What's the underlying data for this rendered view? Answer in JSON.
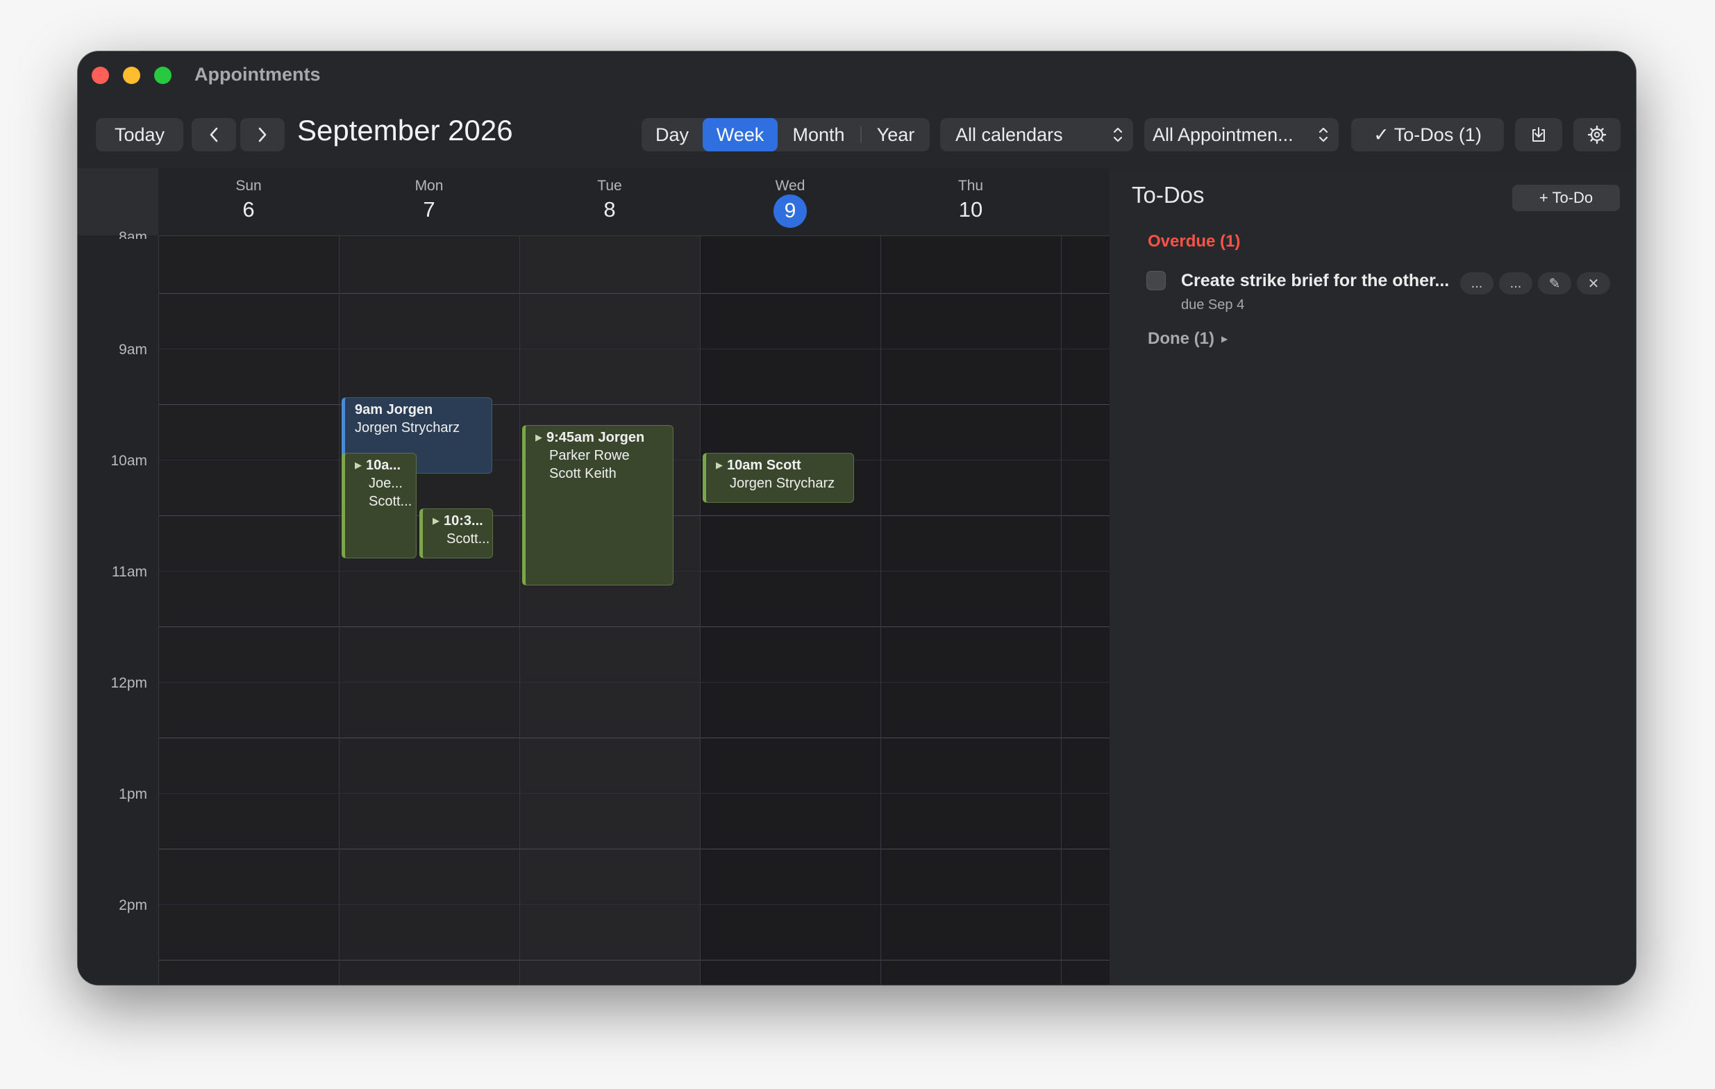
{
  "window": {
    "title": "Appointments"
  },
  "toolbar": {
    "today_label": "Today",
    "month_title": "September 2026",
    "view_modes": [
      "Day",
      "Week",
      "Month",
      "Year"
    ],
    "active_view": "Week",
    "calendar_filter": "All calendars",
    "appointment_filter": "All Appointmen...",
    "todos_toggle": "✓ To-Dos (1)"
  },
  "calendar": {
    "days": [
      {
        "dow": "Sun",
        "num": "6"
      },
      {
        "dow": "Mon",
        "num": "7"
      },
      {
        "dow": "Tue",
        "num": "8"
      },
      {
        "dow": "Wed",
        "num": "9",
        "today": true
      },
      {
        "dow": "Thu",
        "num": "10"
      }
    ],
    "hours": [
      "8am",
      "9am",
      "10am",
      "11am",
      "12pm",
      "1pm",
      "2pm"
    ],
    "events": [
      {
        "day": "Mon",
        "title": "9am Jorgen",
        "line2": "Jorgen Strycharz",
        "color": "blue"
      },
      {
        "day": "Mon",
        "title": "10a...",
        "line2": "Joe...",
        "line3": "Scott...",
        "color": "green"
      },
      {
        "day": "Mon",
        "title": "10:3...",
        "line2": "Scott...",
        "color": "green"
      },
      {
        "day": "Tue",
        "title": "9:45am Jorgen",
        "line2": "Parker Rowe",
        "line3": "Scott Keith",
        "color": "green"
      },
      {
        "day": "Wed",
        "title": "10am Scott",
        "line2": "Jorgen Strycharz",
        "color": "green"
      }
    ]
  },
  "todos": {
    "title": "To-Dos",
    "add_label": "+ To-Do",
    "overdue_header": "Overdue (1)",
    "items": [
      {
        "text": "Create strike brief for the other...",
        "due": "due Sep 4",
        "actions": [
          "...",
          "...",
          "✎",
          "✕"
        ]
      }
    ],
    "done_header": "Done (1)"
  },
  "colors": {
    "accent": "#2f6fe0",
    "overdue": "#ff5347",
    "event_blue": "#4a8ad6",
    "event_green": "#7ba64a"
  }
}
